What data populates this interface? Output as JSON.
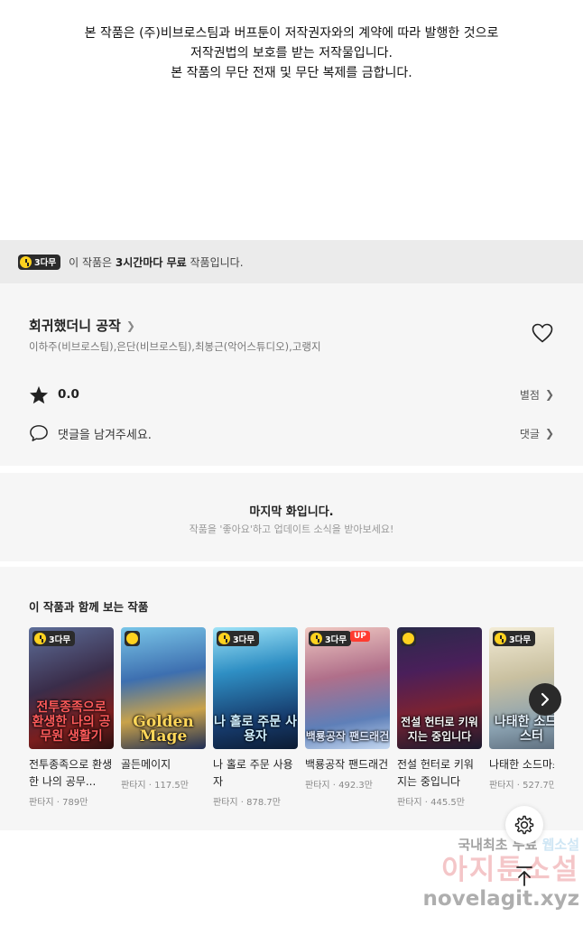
{
  "copyright": {
    "line1": "본 작품은 (주)비브로스팀과 버프툰이 저작권자와의 계약에 따라 발행한 것으로",
    "line2": "저작권법의 보호를 받는 저작물입니다.",
    "line3": "본 작품의 무단 전재 및 무단 복제를 금합니다."
  },
  "free_banner": {
    "badge": "3다무",
    "prefix": "이 작품은 ",
    "bold": "3시간마다 무료",
    "suffix": " 작품입니다."
  },
  "work": {
    "title": "회귀했더니 공작",
    "authors": "이하주(비브로스팀),은단(비브로스팀),최봉근(악어스튜디오),고랭지",
    "rating": "0.0",
    "rate_label": "별점",
    "comment_placeholder": "댓글을 남겨주세요.",
    "comment_label": "댓글"
  },
  "last_episode": {
    "title": "마지막 화입니다.",
    "subtitle": "작품을 '좋아요'하고 업데이트 소식을 받아보세요!"
  },
  "recommendations": {
    "title": "이 작품과 함께 보는 작품",
    "items": [
      {
        "name": "전투종족으로 환생한 나의 공무...",
        "meta": "판타지 · 789만",
        "badge": "3다무",
        "art": "전투종족으로 환생한 나의 공무원 생활기"
      },
      {
        "name": "골든메이지",
        "meta": "판타지 · 117.5만",
        "badge": "",
        "art": "Golden Mage"
      },
      {
        "name": "나 홀로 주문 사용자",
        "meta": "판타지 · 878.7만",
        "badge": "3다무",
        "art": "나 홀로 주문 사용자"
      },
      {
        "name": "백룡공작 팬드래건",
        "meta": "판타지 · 492.3만",
        "badge": "3다무",
        "art": "백룡공작 팬드래건"
      },
      {
        "name": "전설 헌터로 키워지는 중입니다",
        "meta": "판타지 · 445.5만",
        "badge": "",
        "art": "전설 헌터로 키워지는 중입니다"
      },
      {
        "name": "나태한 소드마스터",
        "meta": "판타지 · 527.7만",
        "badge": "3다무",
        "art": "나태한 소드마스터"
      }
    ],
    "up_label": "UP"
  },
  "icons": {
    "heart": "heart-icon",
    "star": "star-icon",
    "comment": "comment-icon",
    "next": "chevron-right-icon",
    "settings": "gear-icon",
    "top": "arrow-up-icon"
  },
  "watermark": {
    "line1a": "국내최초 무료 ",
    "line1b": "웹소설",
    "line2": "아지툰소설",
    "line3": "novelagit.xyz"
  }
}
